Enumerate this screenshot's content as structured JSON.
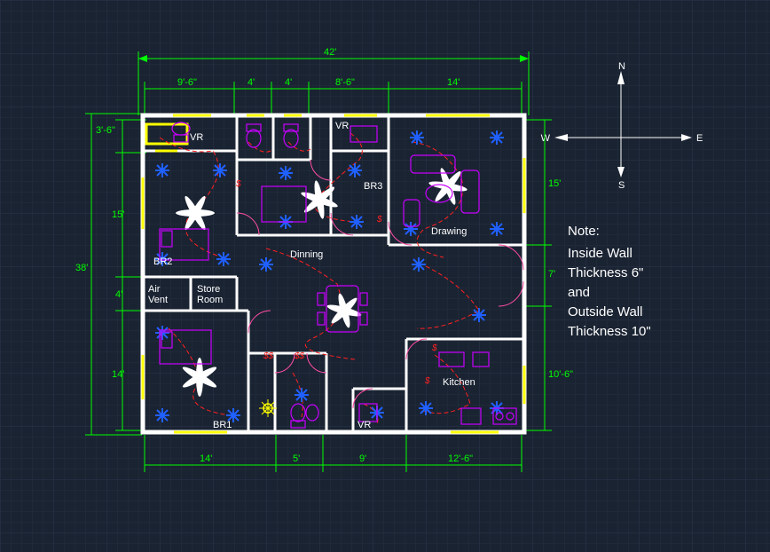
{
  "compass": {
    "n": "N",
    "s": "S",
    "e": "E",
    "w": "W"
  },
  "dims": {
    "top_total": "42'",
    "top_seg1": "9'-6\"",
    "top_seg2": "4'",
    "top_seg3": "4'",
    "top_seg4": "8'-6\"",
    "top_seg5": "14'",
    "left_total": "38'",
    "left_upper": "3'-6\"",
    "left_15": "15'",
    "left_mid": "4'",
    "left_14": "14'",
    "right_upper": "15'",
    "right_mid": "7'",
    "right_lower": "10'-6\"",
    "bot_seg1": "14'",
    "bot_seg2": "5'",
    "bot_seg3": "9'",
    "bot_seg4": "12'-6\""
  },
  "rooms": {
    "vr1": "VR",
    "vr2": "VR",
    "vr3": "VR",
    "br1": "BR1",
    "br2": "BR2",
    "br3": "BR3",
    "drawing": "Drawing",
    "dinning": "Dinning",
    "kitchen": "Kitchen",
    "airvent": "Air\nVent",
    "store": "Store\nRoom"
  },
  "note": {
    "heading": "Note:",
    "l1": "Inside Wall",
    "l2": "Thickness 6\"",
    "l3": "and",
    "l4": "Outside Wall",
    "l5": "Thickness 10\""
  }
}
